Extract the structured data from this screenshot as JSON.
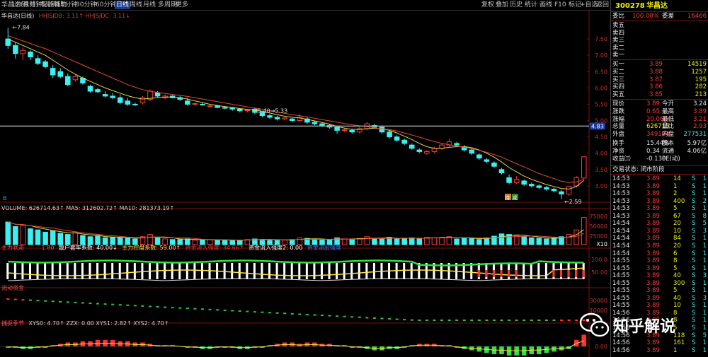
{
  "toolbar": {
    "left": [
      "华昌达(日线)",
      "智能辅助"
    ],
    "periods": [
      "1分钟",
      "1分钟",
      "5分钟",
      "15分钟",
      "30分钟",
      "60分钟",
      "日线",
      "周线",
      "月线",
      "多周期",
      "更多"
    ],
    "active_period": "日线",
    "right": [
      "复权",
      "叠加",
      "历史",
      "统计",
      "画线",
      "F10",
      "标记",
      "+自选",
      "返回"
    ]
  },
  "main_panel": {
    "legend": "HHJSJDB: 3.11↑  HHJSJDC: 3.11↓",
    "high_label": "7.84",
    "low_label": "2.59",
    "annot": "5.40→5.33",
    "price_line_label": "4.83",
    "price_axis": [
      "7.50",
      "7.00",
      "6.50",
      "6.00",
      "5.50",
      "5.00",
      "4.50",
      "4.00",
      "3.50",
      "3.00"
    ],
    "signals": [
      "B",
      "持",
      "减"
    ]
  },
  "chart_data": [
    {
      "type": "candlestick",
      "title": "华昌达(日线)",
      "ylim": [
        2.5,
        8.0
      ],
      "candles": [
        [
          7.5,
          7.84,
          7.2,
          7.3
        ],
        [
          7.3,
          7.4,
          6.9,
          7.05
        ],
        [
          7.05,
          7.25,
          6.85,
          7.15
        ],
        [
          7.1,
          7.15,
          6.85,
          6.95
        ],
        [
          6.9,
          7.0,
          6.7,
          6.75
        ],
        [
          6.8,
          6.85,
          6.6,
          6.65
        ],
        [
          6.6,
          6.7,
          6.3,
          6.4
        ],
        [
          6.5,
          6.6,
          6.3,
          6.35
        ],
        [
          6.35,
          6.45,
          6.05,
          6.1
        ],
        [
          6.25,
          6.4,
          6.2,
          6.35
        ],
        [
          6.3,
          6.35,
          6.1,
          6.15
        ],
        [
          6.05,
          6.1,
          5.85,
          5.9
        ],
        [
          5.95,
          6.0,
          5.85,
          5.88
        ],
        [
          5.8,
          5.9,
          5.7,
          5.75
        ],
        [
          5.75,
          5.85,
          5.65,
          5.7
        ],
        [
          5.7,
          5.8,
          5.5,
          5.55
        ],
        [
          5.6,
          5.7,
          5.45,
          5.5
        ],
        [
          5.5,
          5.55,
          5.45,
          5.48
        ],
        [
          5.55,
          5.75,
          5.5,
          5.7
        ],
        [
          5.65,
          5.95,
          5.6,
          5.9
        ],
        [
          5.85,
          5.9,
          5.7,
          5.75
        ],
        [
          5.7,
          5.8,
          5.65,
          5.75
        ],
        [
          5.75,
          5.78,
          5.68,
          5.7
        ],
        [
          5.7,
          5.75,
          5.6,
          5.65
        ],
        [
          5.6,
          5.7,
          5.45,
          5.5
        ],
        [
          5.5,
          5.55,
          5.45,
          5.52
        ],
        [
          5.5,
          5.55,
          5.45,
          5.48
        ],
        [
          5.45,
          5.5,
          5.4,
          5.45
        ],
        [
          5.45,
          5.48,
          5.38,
          5.4
        ],
        [
          5.4,
          5.45,
          5.35,
          5.38
        ],
        [
          5.38,
          5.42,
          5.3,
          5.35
        ],
        [
          5.35,
          5.38,
          5.25,
          5.3
        ],
        [
          5.3,
          5.35,
          5.25,
          5.32
        ],
        [
          5.35,
          5.4,
          5.2,
          5.25
        ],
        [
          5.25,
          5.3,
          5.1,
          5.15
        ],
        [
          5.15,
          5.2,
          5.05,
          5.1
        ],
        [
          5.1,
          5.15,
          5.0,
          5.05
        ],
        [
          5.05,
          5.1,
          5.0,
          5.08
        ],
        [
          5.05,
          5.08,
          4.95,
          5.0
        ],
        [
          5.0,
          5.2,
          4.95,
          5.1
        ],
        [
          5.05,
          5.1,
          4.9,
          4.95
        ],
        [
          4.95,
          5.0,
          4.85,
          4.9
        ],
        [
          4.9,
          4.95,
          4.8,
          4.85
        ],
        [
          4.85,
          4.9,
          4.75,
          4.8
        ],
        [
          4.8,
          4.85,
          4.6,
          4.7
        ],
        [
          4.7,
          4.75,
          4.65,
          4.72
        ],
        [
          4.7,
          4.75,
          4.6,
          4.65
        ],
        [
          4.65,
          4.8,
          4.6,
          4.75
        ],
        [
          4.75,
          4.95,
          4.7,
          4.9
        ],
        [
          4.85,
          4.9,
          4.75,
          4.8
        ],
        [
          4.8,
          4.85,
          4.6,
          4.65
        ],
        [
          4.65,
          4.7,
          4.45,
          4.5
        ],
        [
          4.5,
          4.55,
          4.35,
          4.4
        ],
        [
          4.4,
          4.45,
          4.25,
          4.3
        ],
        [
          4.25,
          4.3,
          4.1,
          4.15
        ],
        [
          4.1,
          4.15,
          4.0,
          4.05
        ],
        [
          4.0,
          4.1,
          3.95,
          4.05
        ],
        [
          4.05,
          4.2,
          4.0,
          4.15
        ],
        [
          4.15,
          4.3,
          4.1,
          4.25
        ],
        [
          4.25,
          4.45,
          4.2,
          4.35
        ],
        [
          4.3,
          4.35,
          4.2,
          4.25
        ],
        [
          4.2,
          4.25,
          4.05,
          4.1
        ],
        [
          4.1,
          4.15,
          3.95,
          4.0
        ],
        [
          3.95,
          4.0,
          3.8,
          3.85
        ],
        [
          3.8,
          3.85,
          3.7,
          3.75
        ],
        [
          3.7,
          3.75,
          3.55,
          3.6
        ],
        [
          3.5,
          3.55,
          3.35,
          3.4
        ],
        [
          3.25,
          3.35,
          3.05,
          3.1
        ],
        [
          3.1,
          3.3,
          3.05,
          3.2
        ],
        [
          3.15,
          3.2,
          3.0,
          3.05
        ],
        [
          3.05,
          3.1,
          2.95,
          3.0
        ],
        [
          3.0,
          3.05,
          2.9,
          2.95
        ],
        [
          2.95,
          3.0,
          2.85,
          2.9
        ],
        [
          2.9,
          2.95,
          2.8,
          2.85
        ],
        [
          2.82,
          2.88,
          2.59,
          2.75
        ],
        [
          2.75,
          3.0,
          2.7,
          2.98
        ],
        [
          3.0,
          3.3,
          2.95,
          3.25
        ],
        [
          3.24,
          3.89,
          3.2,
          3.89
        ]
      ],
      "ma": [
        {
          "name": "MA5",
          "color": "#e8d34a",
          "values": [
            7.5,
            7.4,
            7.3,
            7.2,
            7.1,
            7.0,
            6.85,
            6.7,
            6.55,
            6.42,
            6.3,
            6.2,
            6.1,
            6.0,
            5.92,
            5.84,
            5.76,
            5.7,
            5.66,
            5.68,
            5.7,
            5.72,
            5.72,
            5.7,
            5.66,
            5.6,
            5.55,
            5.5,
            5.46,
            5.43,
            5.4,
            5.37,
            5.34,
            5.32,
            5.28,
            5.23,
            5.18,
            5.13,
            5.1,
            5.08,
            5.04,
            4.99,
            4.94,
            4.89,
            4.82,
            4.77,
            4.73,
            4.73,
            4.75,
            4.77,
            4.75,
            4.7,
            4.62,
            4.52,
            4.42,
            4.3,
            4.2,
            4.15,
            4.15,
            4.18,
            4.2,
            4.2,
            4.17,
            4.1,
            4.0,
            3.88,
            3.73,
            3.56,
            3.43,
            3.3,
            3.2,
            3.12,
            3.04,
            2.98,
            2.92,
            2.9,
            2.98,
            3.17
          ]
        },
        {
          "name": "MA10",
          "color": "#e04a3a",
          "values": [
            7.6,
            7.52,
            7.44,
            7.36,
            7.28,
            7.2,
            7.1,
            7.0,
            6.9,
            6.8,
            6.7,
            6.6,
            6.5,
            6.4,
            6.3,
            6.2,
            6.1,
            6.02,
            5.95,
            5.9,
            5.86,
            5.83,
            5.8,
            5.77,
            5.74,
            5.7,
            5.66,
            5.62,
            5.58,
            5.54,
            5.5,
            5.46,
            5.42,
            5.38,
            5.34,
            5.3,
            5.26,
            5.22,
            5.18,
            5.15,
            5.11,
            5.07,
            5.03,
            4.99,
            4.95,
            4.91,
            4.87,
            4.84,
            4.81,
            4.78,
            4.75,
            4.72,
            4.68,
            4.62,
            4.56,
            4.49,
            4.42,
            4.36,
            4.3,
            4.26,
            4.22,
            4.18,
            4.14,
            4.09,
            4.03,
            3.96,
            3.88,
            3.78,
            3.68,
            3.58,
            3.48,
            3.38,
            3.3,
            3.22,
            3.14,
            3.1,
            3.12,
            3.2
          ]
        }
      ]
    },
    {
      "type": "bar",
      "title": "VOLUME",
      "legend": "VOLUME: 626714.63↑  MA5: 312602.72↑  MA10: 281373.19↑",
      "y_ticks": [
        "75000",
        "50000",
        "25000",
        "X10"
      ],
      "values": [
        40,
        32,
        34,
        28,
        26,
        22,
        24,
        20,
        18,
        21,
        16,
        14,
        15,
        12,
        13,
        12,
        11,
        10,
        14,
        18,
        12,
        10,
        9,
        9,
        10,
        8,
        8,
        9,
        8,
        8,
        7,
        8,
        9,
        10,
        9,
        8,
        8,
        8,
        9,
        12,
        11,
        9,
        8,
        9,
        12,
        10,
        9,
        11,
        14,
        11,
        10,
        13,
        11,
        10,
        12,
        11,
        13,
        12,
        13,
        14,
        10,
        12,
        11,
        9,
        12,
        15,
        19,
        18,
        16,
        14,
        12,
        11,
        10,
        12,
        14,
        18,
        26,
        48
      ],
      "ylim": [
        0,
        50
      ]
    },
    {
      "type": "bar",
      "title": "主力状态",
      "legend": [
        "1.80",
        "散户套牢系数: 40.00↓",
        "主力控盘系数: 59.00↑",
        "资金流入强度: 34.66↑",
        "资金流入强度2: 0.00",
        "资金流出强度"
      ],
      "y_ticks": [
        "100.0",
        "50.00"
      ],
      "ylim": [
        0,
        100
      ]
    },
    {
      "type": "bar",
      "title": "流动资金",
      "y_ticks": [
        "30000",
        "10000"
      ]
    },
    {
      "type": "bar",
      "title": "捕捉季节",
      "legend": "XYS0: 4.70↑  ZZX: 0.00  XYS1: 2.82↑  XYS2: 4.70↑",
      "y_ticks": [
        "0.00"
      ],
      "values": [
        -1,
        -1,
        -2,
        -2,
        -1,
        -1,
        1,
        2,
        3,
        3,
        4,
        4,
        5,
        5,
        5,
        4,
        4,
        3,
        3,
        2,
        1,
        1,
        1,
        0,
        -1,
        -1,
        -2,
        -2,
        -1,
        -1,
        -1,
        -2,
        -2,
        -1,
        -1,
        1,
        2,
        3,
        3,
        2,
        3,
        3,
        2,
        2,
        1,
        1,
        -1,
        -1,
        -2,
        -3,
        -3,
        -2,
        -2,
        -1,
        1,
        2,
        2,
        2,
        1,
        1,
        -1,
        -2,
        -3,
        -4,
        -5,
        -6,
        -6,
        -7,
        -7,
        -7,
        -6,
        -6,
        -5,
        -4,
        -3,
        -2,
        5,
        9
      ],
      "ylim": [
        -8,
        10
      ]
    }
  ],
  "right_panel": {
    "code": "300278",
    "name": "华昌达",
    "weibi_label": "委比",
    "weibi": "100.00%",
    "weicha_label": "委差",
    "weicha": "16466",
    "sell": [
      {
        "label": "卖五",
        "price": "",
        "vol": ""
      },
      {
        "label": "卖四",
        "price": "",
        "vol": ""
      },
      {
        "label": "卖三",
        "price": "",
        "vol": ""
      },
      {
        "label": "卖二",
        "price": "",
        "vol": ""
      },
      {
        "label": "卖一",
        "price": "",
        "vol": ""
      }
    ],
    "buy": [
      {
        "label": "买一",
        "price": "3.89",
        "vol": "14519"
      },
      {
        "label": "买二",
        "price": "3.88",
        "vol": "1257"
      },
      {
        "label": "买三",
        "price": "3.87",
        "vol": "195"
      },
      {
        "label": "买四",
        "price": "3.86",
        "vol": "282"
      },
      {
        "label": "买五",
        "price": "3.85",
        "vol": "213"
      }
    ],
    "stats": [
      [
        "现价",
        "3.89",
        "今开",
        "3.24"
      ],
      [
        "涨跌",
        "0.65",
        "最高",
        "3.89"
      ],
      [
        "涨幅",
        "20.06%",
        "最低",
        "3.21"
      ],
      [
        "总量",
        "626715",
        "量比",
        "2.93"
      ],
      [
        "外盘",
        "349184",
        "内盘",
        "277531"
      ],
      [
        "换手",
        "15.44%",
        "股本",
        "5.97亿"
      ],
      [
        "净资",
        "0.34",
        "流通",
        "4.06亿"
      ],
      [
        "收益㈢",
        "-0.130",
        "PE(动)",
        ""
      ]
    ],
    "trade_status": "交易状态: 闭市阶段",
    "ticks": [
      [
        "14:53",
        "3.89",
        "14",
        "S",
        "1"
      ],
      [
        "14:53",
        "3.89",
        "1",
        "S",
        "1"
      ],
      [
        "14:53",
        "3.89",
        "2",
        "S",
        "1"
      ],
      [
        "14:53",
        "3.89",
        "400",
        "S",
        "2"
      ],
      [
        "14:53",
        "3.89",
        "5",
        "S",
        "1"
      ],
      [
        "14:53",
        "3.89",
        "67",
        "S",
        "8"
      ],
      [
        "14:54",
        "3.89",
        "20",
        "S",
        "5"
      ],
      [
        "14:54",
        "3.89",
        "10",
        "S",
        "3"
      ],
      [
        "14:54",
        "3.89",
        "84",
        "S",
        "1"
      ],
      [
        "14:54",
        "3.89",
        "20",
        "S",
        "1"
      ],
      [
        "14:54",
        "3.89",
        "6",
        "S",
        "1"
      ],
      [
        "14:55",
        "3.89",
        "8",
        "S",
        "1"
      ],
      [
        "14:55",
        "3.89",
        "5",
        "S",
        "1"
      ],
      [
        "14:55",
        "3.89",
        "40",
        "S",
        "3"
      ],
      [
        "14:55",
        "3.89",
        "300",
        "S",
        "1"
      ],
      [
        "14:55",
        "3.89",
        "5",
        "S",
        "1"
      ],
      [
        "14:55",
        "3.89",
        "40",
        "S",
        "3"
      ],
      [
        "14:55",
        "3.89",
        "10",
        "S",
        "1"
      ],
      [
        "14:56",
        "3.89",
        "8",
        "S",
        "1"
      ],
      [
        "14:56",
        "3.89",
        "8",
        "S",
        "1"
      ],
      [
        "14:56",
        "3.89",
        "5",
        "S",
        "1"
      ],
      [
        "14:56",
        "3.89",
        "118",
        "S",
        "5"
      ],
      [
        "14:56",
        "3.89",
        "161",
        "S",
        "1"
      ],
      [
        "14:56",
        "3.89",
        "1",
        "S",
        "1"
      ]
    ]
  },
  "watermark": {
    "text": "知乎解说"
  },
  "colors": {
    "up": "#ff3838",
    "down": "#3af0f0",
    "ma5": "#e8d34a",
    "ma10": "#e04a3a",
    "active_tab": "#1c3a8a"
  }
}
